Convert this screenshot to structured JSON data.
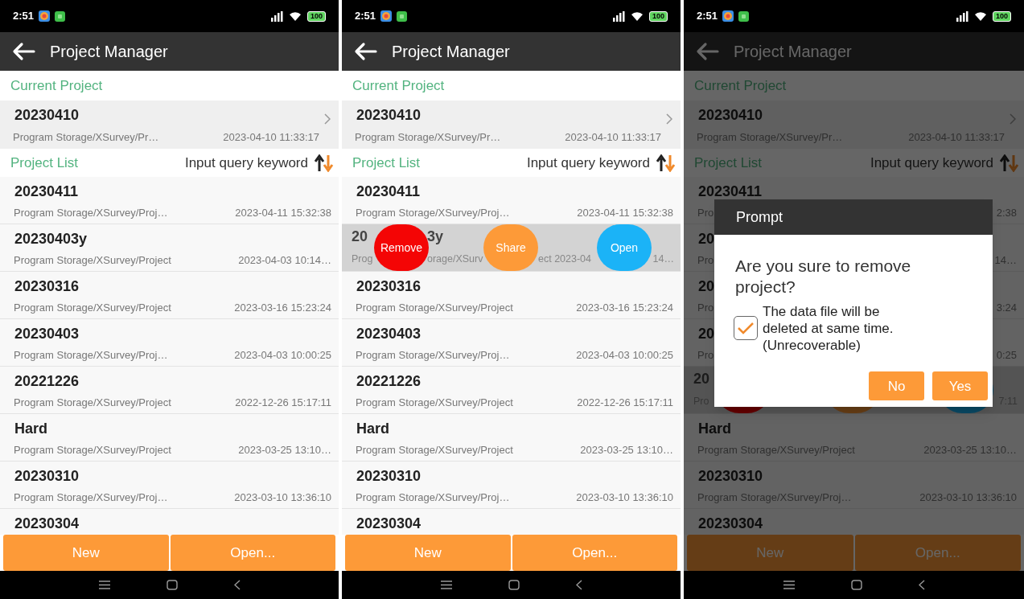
{
  "screens": [
    {
      "status_bar": {
        "time": "2:51",
        "battery": "100"
      },
      "app_bar": {
        "title": "Project Manager"
      },
      "current_section": "Current Project",
      "current_project": {
        "name": "20230410",
        "path": "Program Storage/XSurvey/Pr…",
        "date": "2023-04-10 11:33:17"
      },
      "list_section": "Project List",
      "search": {
        "placeholder": "Input query keyword"
      },
      "projects": [
        {
          "name": "20230411",
          "path": "Program Storage/XSurvey/Proj…",
          "date": "2023-04-11 15:32:38",
          "selected": false
        },
        {
          "name": "20230403y",
          "path": "Program Storage/XSurvey/Project",
          "date": "2023-04-03 10:14…",
          "selected": false
        },
        {
          "name": "20230316",
          "path": "Program Storage/XSurvey/Project",
          "date": "2023-03-16 15:23:24",
          "selected": false
        },
        {
          "name": "20230403",
          "path": "Program Storage/XSurvey/Proj…",
          "date": "2023-04-03 10:00:25",
          "selected": false
        },
        {
          "name": "20221226",
          "path": "Program Storage/XSurvey/Project",
          "date": "2022-12-26 15:17:11",
          "selected": false
        },
        {
          "name": "Hard",
          "path": "Program Storage/XSurvey/Project",
          "date": "2023-03-25 13:10…",
          "selected": false
        },
        {
          "name": "20230310",
          "path": "Program Storage/XSurvey/Proj…",
          "date": "2023-03-10 13:36:10",
          "selected": false
        },
        {
          "name": "20230304",
          "selected": false
        }
      ],
      "buttons": [
        "New",
        "Open..."
      ],
      "dimmed": false
    },
    {
      "status_bar": {
        "time": "2:51",
        "battery": "100"
      },
      "app_bar": {
        "title": "Project Manager"
      },
      "current_section": "Current Project",
      "current_project": {
        "name": "20230410",
        "path": "Program Storage/XSurvey/Pr…",
        "date": "2023-04-10 11:33:17"
      },
      "list_section": "Project List",
      "search": {
        "placeholder": "Input query keyword"
      },
      "projects": [
        {
          "name": "20230411",
          "path": "Program Storage/XSurvey/Proj…",
          "date": "2023-04-11 15:32:38",
          "selected": false
        },
        {
          "selected": true,
          "segments": [
            {
              "name": "20",
              "path": "Prog"
            },
            {
              "name": "3y",
              "path": "orage/XSurv"
            },
            {
              "path": "ect 2023-04"
            },
            {
              "path": "14…"
            }
          ],
          "actions": [
            {
              "kind": "remove",
              "label": "Remove"
            },
            {
              "kind": "share",
              "label": "Share"
            },
            {
              "kind": "open",
              "label": "Open"
            }
          ]
        },
        {
          "name": "20230316",
          "path": "Program Storage/XSurvey/Project",
          "date": "2023-03-16 15:23:24",
          "selected": false
        },
        {
          "name": "20230403",
          "path": "Program Storage/XSurvey/Proj…",
          "date": "2023-04-03 10:00:25",
          "selected": false
        },
        {
          "name": "20221226",
          "path": "Program Storage/XSurvey/Project",
          "date": "2022-12-26 15:17:11",
          "selected": false
        },
        {
          "name": "Hard",
          "path": "Program Storage/XSurvey/Project",
          "date": "2023-03-25 13:10…",
          "selected": false
        },
        {
          "name": "20230310",
          "path": "Program Storage/XSurvey/Proj…",
          "date": "2023-03-10 13:36:10",
          "selected": false
        },
        {
          "name": "20230304",
          "selected": false
        }
      ],
      "buttons": [
        "New",
        "Open..."
      ],
      "dimmed": false
    },
    {
      "status_bar": {
        "time": "2:51",
        "battery": "100"
      },
      "app_bar": {
        "title": "Project Manager"
      },
      "current_section": "Current Project",
      "current_project": {
        "name": "20230410",
        "path": "Program Storage/XSurvey/Pr…",
        "date": "2023-04-10 11:33:17"
      },
      "list_section": "Project List",
      "search": {
        "placeholder": "Input query keyword"
      },
      "projects": [
        {
          "name": "20230411",
          "path": "Pro",
          "date": "2:38",
          "selected": false
        },
        {
          "name": "20",
          "path": "Pro",
          "date": "14…",
          "selected": false
        },
        {
          "name": "20",
          "path": "Pro",
          "date": "3:24",
          "selected": false
        },
        {
          "name": "20",
          "path": "Pro",
          "date": "0:25",
          "selected": false
        },
        {
          "selected": true,
          "segments": [
            {
              "name": "20",
              "path": "Pro"
            },
            {
              "path": "7:11"
            }
          ],
          "actions": [
            {
              "kind": "remove"
            },
            {
              "kind": "share"
            },
            {
              "kind": "open"
            }
          ]
        },
        {
          "name": "Hard",
          "path": "Program Storage/XSurvey/Project",
          "date": "2023-03-25 13:10…",
          "selected": false
        },
        {
          "name": "20230310",
          "path": "Program Storage/XSurvey/Proj…",
          "date": "2023-03-10 13:36:10",
          "selected": false
        },
        {
          "name": "20230304",
          "selected": false
        }
      ],
      "buttons": [
        "New",
        "Open..."
      ],
      "dimmed": true,
      "dialog": {
        "title": "Prompt",
        "message": "Are you sure to remove project?",
        "checkbox": {
          "label": "The data file will be deleted at same time. (Unrecoverable)",
          "checked": true
        },
        "buttons": [
          "No",
          "Yes"
        ]
      }
    }
  ]
}
